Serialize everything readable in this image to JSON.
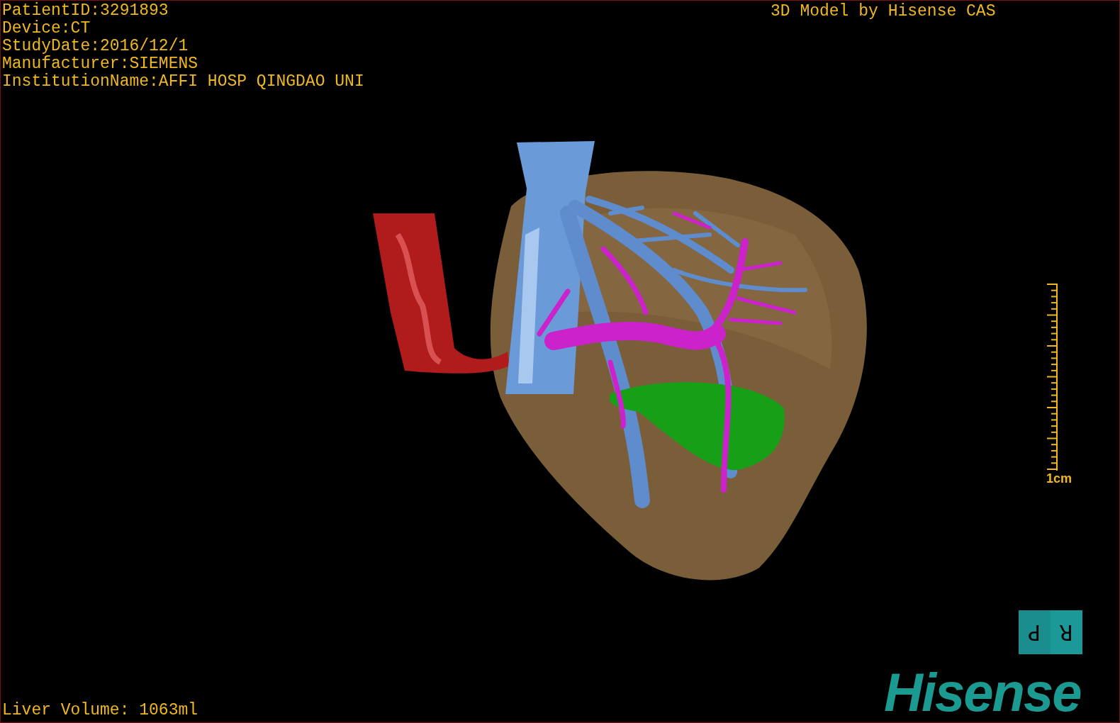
{
  "patient_info": [
    "PatientID:3291893",
    "Device:CT",
    "StudyDate:2016/12/1",
    "Manufacturer:SIEMENS",
    "InstitutionName:AFFI HOSP QINGDAO UNI"
  ],
  "header_right": "3D Model by Hisense CAS",
  "scale_bar": {
    "label": "1cm"
  },
  "orientation_cube": {
    "left_face": "P",
    "right_face": "R"
  },
  "logo": "Hisense",
  "liver_volume": "Liver Volume: 1063ml"
}
